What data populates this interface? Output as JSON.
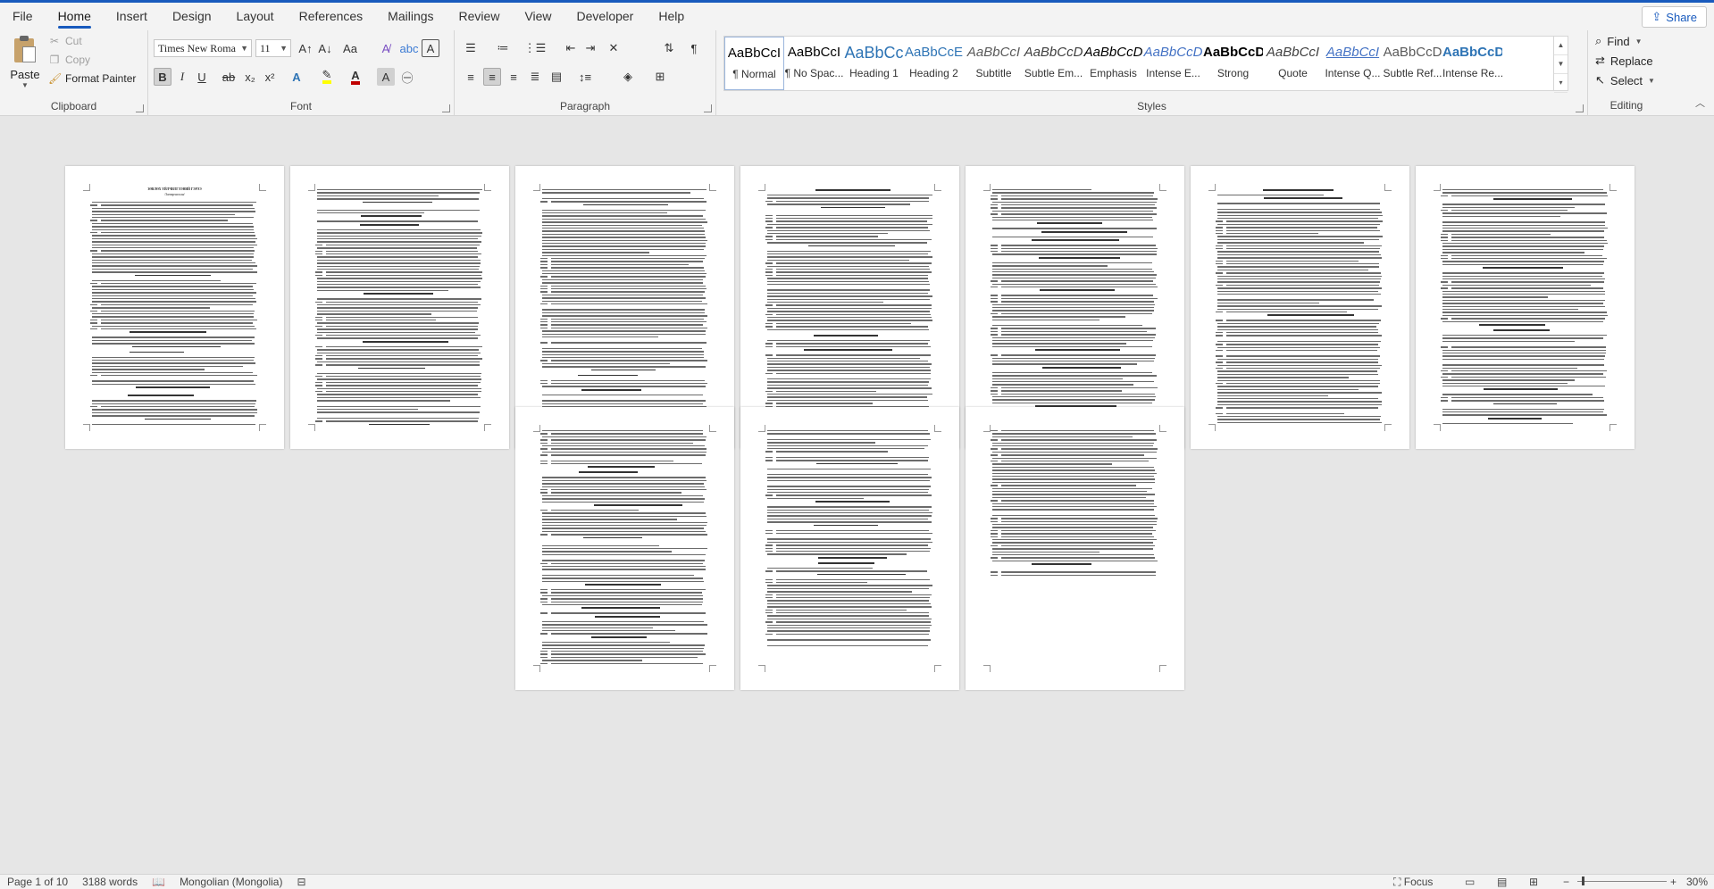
{
  "menu": {
    "tabs": [
      "File",
      "Home",
      "Insert",
      "Design",
      "Layout",
      "References",
      "Mailings",
      "Review",
      "View",
      "Developer",
      "Help"
    ],
    "active_tab": "Home",
    "share_label": "Share"
  },
  "clipboard": {
    "paste_label": "Paste",
    "cut_label": "Cut",
    "copy_label": "Copy",
    "format_painter_label": "Format Painter",
    "group_label": "Clipboard"
  },
  "font": {
    "font_name": "Times New Roma",
    "font_size": "11",
    "group_label": "Font",
    "bold": "B",
    "italic": "I",
    "underline": "U",
    "strike": "ab",
    "subscript": "x₂",
    "superscript": "x²",
    "grow": "A↑",
    "shrink": "A↓",
    "change_case": "Aa",
    "font_color": "#c00000",
    "highlight_color": "#ffff00"
  },
  "paragraph": {
    "group_label": "Paragraph"
  },
  "styles": {
    "group_label": "Styles",
    "items": [
      {
        "sample": "AaBbCcI",
        "name": "¶ Normal",
        "color": "#000000"
      },
      {
        "sample": "AaBbCcI",
        "name": "¶ No Spac...",
        "color": "#000000"
      },
      {
        "sample": "AaBbCc",
        "name": "Heading 1",
        "color": "#2e74b5"
      },
      {
        "sample": "AaBbCcE",
        "name": "Heading 2",
        "color": "#2e74b5"
      },
      {
        "sample": "AaBbCcI",
        "name": "Subtitle",
        "color": "#5a5a5a"
      },
      {
        "sample": "AaBbCcD",
        "name": "Subtle Em...",
        "color": "#404040"
      },
      {
        "sample": "AaBbCcD",
        "name": "Emphasis",
        "color": "#000000"
      },
      {
        "sample": "AaBbCcD",
        "name": "Intense E...",
        "color": "#4472c4"
      },
      {
        "sample": "AaBbCcD",
        "name": "Strong",
        "color": "#000000"
      },
      {
        "sample": "AaBbCcI",
        "name": "Quote",
        "color": "#404040"
      },
      {
        "sample": "AaBbCcI",
        "name": "Intense Q...",
        "color": "#4472c4"
      },
      {
        "sample": "AaBbCcD",
        "name": "Subtle Ref...",
        "color": "#5a5a5a"
      },
      {
        "sample": "AaBbCcD",
        "name": "Intense Re...",
        "color": "#2e74b5"
      }
    ]
  },
  "editing": {
    "group_label": "Editing",
    "find_label": "Find",
    "replace_label": "Replace",
    "select_label": "Select"
  },
  "status": {
    "page": "Page 1 of 10",
    "words": "3188 words",
    "language": "Mongolian (Mongolia)",
    "focus_label": "Focus",
    "zoom": "30%"
  },
  "document": {
    "page1_title": "ЗӨВЛӨХ ҮЙЛЧИЛГЭЭНИЙ ГЭРЭЭ",
    "page1_subtitle": "/Загварчилсан/"
  }
}
